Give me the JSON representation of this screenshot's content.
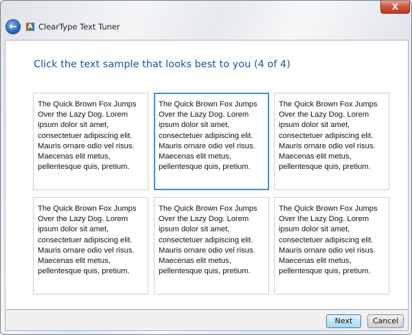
{
  "window": {
    "title": "ClearType Text Tuner",
    "close_label": "X",
    "back_icon": "back-arrow-icon",
    "app_icon_letter": "A"
  },
  "heading": "Click the text sample that looks best to you (4 of 4)",
  "samples": [
    {
      "text": "The Quick Brown Fox Jumps Over the Lazy Dog. Lorem ipsum dolor sit amet, consectetuer adipiscing elit. Mauris ornare odio vel risus. Maecenas elit metus, pellentesque quis, pretium.",
      "selected": false
    },
    {
      "text": "The Quick Brown Fox Jumps Over the Lazy Dog. Lorem ipsum dolor sit amet, consectetuer adipiscing elit. Mauris ornare odio vel risus. Maecenas elit metus, pellentesque quis, pretium.",
      "selected": true
    },
    {
      "text": "The Quick Brown Fox Jumps Over the Lazy Dog. Lorem ipsum dolor sit amet, consectetuer adipiscing elit. Mauris ornare odio vel risus. Maecenas elit metus, pellentesque quis, pretium.",
      "selected": false
    },
    {
      "text": "The Quick Brown Fox Jumps Over the Lazy Dog. Lorem ipsum dolor sit amet, consectetuer adipiscing elit. Mauris ornare odio vel risus. Maecenas elit metus, pellentesque quis, pretium.",
      "selected": false
    },
    {
      "text": "The Quick Brown Fox Jumps Over the Lazy Dog. Lorem ipsum dolor sit amet, consectetuer adipiscing elit. Mauris ornare odio vel risus. Maecenas elit metus, pellentesque quis, pretium.",
      "selected": false
    },
    {
      "text": "The Quick Brown Fox Jumps Over the Lazy Dog. Lorem ipsum dolor sit amet, consectetuer adipiscing elit. Mauris ornare odio vel risus. Maecenas elit metus, pellentesque quis, pretium.",
      "selected": false
    }
  ],
  "buttons": {
    "next": "Next",
    "cancel": "Cancel"
  },
  "colors": {
    "heading": "#1f4fa8",
    "selection": "#3d8de0"
  }
}
